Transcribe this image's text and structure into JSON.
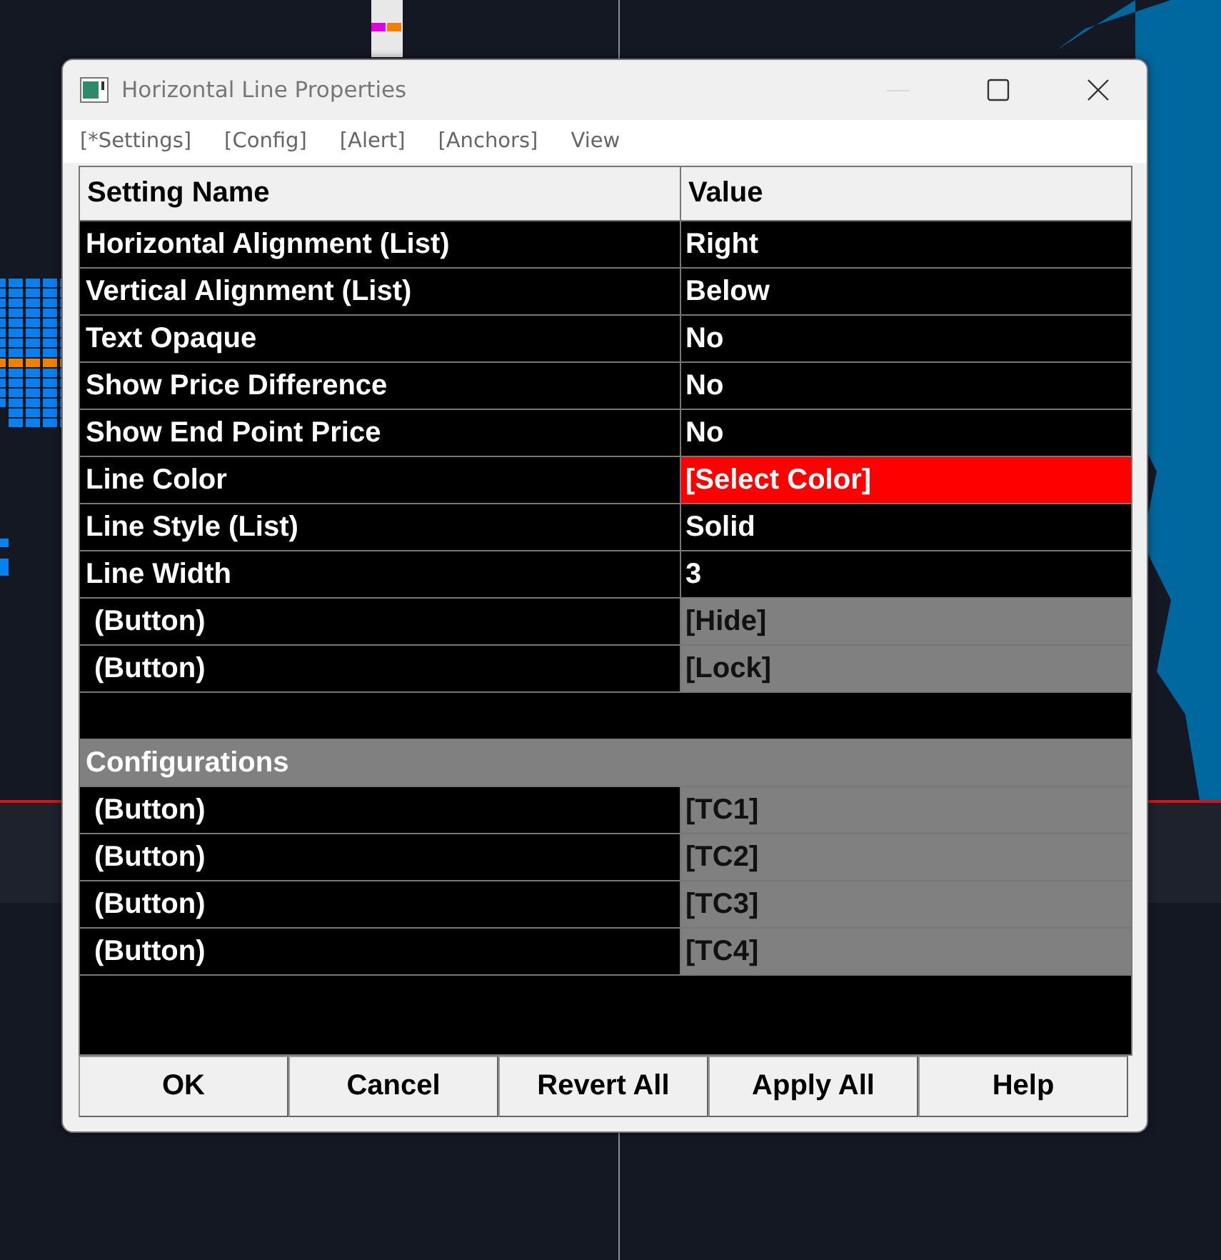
{
  "window": {
    "title": "Horizontal Line Properties"
  },
  "menu": [
    "[*Settings]",
    "[Config]",
    "[Alert]",
    "[Anchors]",
    "View"
  ],
  "table": {
    "columns": [
      "Setting Name",
      "Value"
    ],
    "rows": [
      {
        "kind": "text",
        "name": "Horizontal Alignment (List)",
        "value": "Right"
      },
      {
        "kind": "text",
        "name": "Vertical Alignment (List)",
        "value": "Below"
      },
      {
        "kind": "text",
        "name": "Text Opaque",
        "value": "No"
      },
      {
        "kind": "text",
        "name": "Show Price Difference",
        "value": "No"
      },
      {
        "kind": "text",
        "name": "Show End Point Price",
        "value": "No"
      },
      {
        "kind": "color",
        "name": "Line Color",
        "value": "[Select Color]",
        "color": "#ff0000"
      },
      {
        "kind": "text",
        "name": "Line Style (List)",
        "value": "Solid"
      },
      {
        "kind": "text",
        "name": "Line Width",
        "value": "3"
      },
      {
        "kind": "button",
        "name": "(Button)",
        "value": "[Hide]"
      },
      {
        "kind": "button",
        "name": "(Button)",
        "value": "[Lock]"
      },
      {
        "kind": "blank"
      },
      {
        "kind": "section",
        "name": "Configurations"
      },
      {
        "kind": "button",
        "name": "(Button)",
        "value": "[TC1]"
      },
      {
        "kind": "button",
        "name": "(Button)",
        "value": "[TC2]"
      },
      {
        "kind": "button",
        "name": "(Button)",
        "value": "[TC3]"
      },
      {
        "kind": "button",
        "name": "(Button)",
        "value": "[TC4]"
      }
    ]
  },
  "buttons": [
    "OK",
    "Cancel",
    "Revert All",
    "Apply All",
    "Help"
  ]
}
